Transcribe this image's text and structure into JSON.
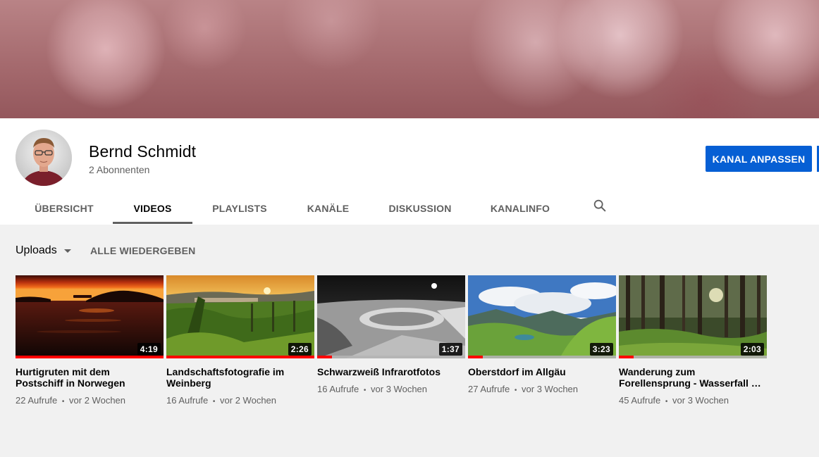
{
  "channel": {
    "name": "Bernd Schmidt",
    "subscribers": "2 Abonnenten",
    "customize_label": "KANAL ANPASSEN"
  },
  "tabs": [
    {
      "label": "ÜBERSICHT",
      "active": false
    },
    {
      "label": "VIDEOS",
      "active": true
    },
    {
      "label": "PLAYLISTS",
      "active": false
    },
    {
      "label": "KANÄLE",
      "active": false
    },
    {
      "label": "DISKUSSION",
      "active": false
    },
    {
      "label": "KANALINFO",
      "active": false
    }
  ],
  "uploads": {
    "selector_label": "Uploads",
    "play_all_label": "ALLE WIEDERGEBEN"
  },
  "videos": [
    {
      "title": "Hurtigruten mit dem Postschiff in Norwegen",
      "duration": "4:19",
      "views": "22 Aufrufe",
      "age": "vor 2 Wochen",
      "watched_fraction": 1.0
    },
    {
      "title": "Landschaftsfotografie im Weinberg",
      "duration": "2:26",
      "views": "16 Aufrufe",
      "age": "vor 2 Wochen",
      "watched_fraction": 1.0
    },
    {
      "title": "Schwarzweiß Infrarotfotos",
      "duration": "1:37",
      "views": "16 Aufrufe",
      "age": "vor 3 Wochen",
      "watched_fraction": 0.1
    },
    {
      "title": "Oberstdorf im Allgäu",
      "duration": "3:23",
      "views": "27 Aufrufe",
      "age": "vor 3 Wochen",
      "watched_fraction": 0.1
    },
    {
      "title": "Wanderung zum Forellensprung - Wasserfall …",
      "duration": "2:03",
      "views": "45 Aufrufe",
      "age": "vor 3 Wochen",
      "watched_fraction": 0.1
    }
  ],
  "meta_separator": "•",
  "colors": {
    "accent_button": "#065fd4",
    "progress": "#ff0000",
    "text_secondary": "#606060"
  }
}
